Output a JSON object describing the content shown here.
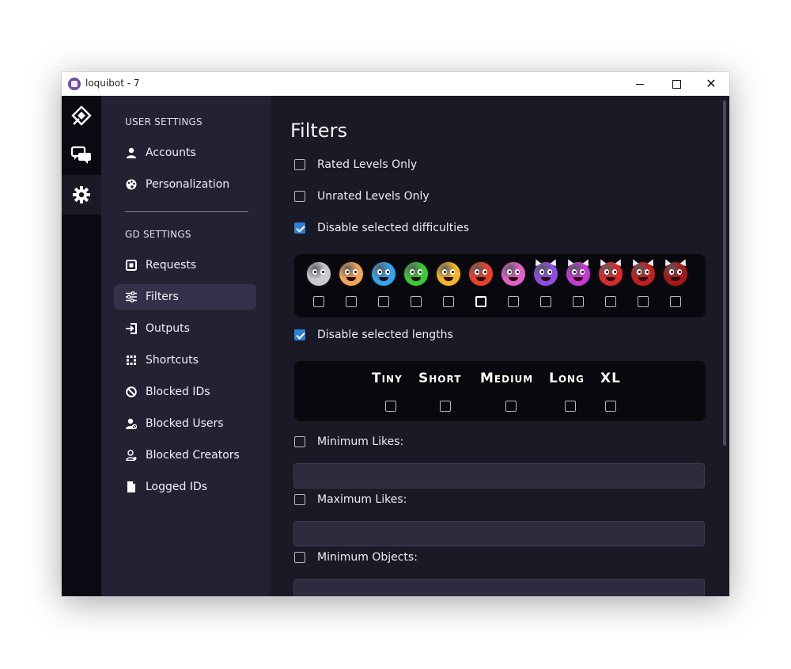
{
  "window": {
    "title": "loquibot - 7"
  },
  "sidebar": {
    "user_settings_label": "USER SETTINGS",
    "gd_settings_label": "GD SETTINGS",
    "items": [
      {
        "label": "Accounts",
        "icon": "user-icon"
      },
      {
        "label": "Personalization",
        "icon": "palette-icon"
      },
      {
        "label": "Requests",
        "icon": "requests-icon"
      },
      {
        "label": "Filters",
        "icon": "sliders-icon",
        "active": true
      },
      {
        "label": "Outputs",
        "icon": "output-icon"
      },
      {
        "label": "Shortcuts",
        "icon": "keyboard-icon"
      },
      {
        "label": "Blocked IDs",
        "icon": "ban-icon"
      },
      {
        "label": "Blocked Users",
        "icon": "user-blocked-icon"
      },
      {
        "label": "Blocked Creators",
        "icon": "user-outline-icon"
      },
      {
        "label": "Logged IDs",
        "icon": "file-icon"
      }
    ]
  },
  "main": {
    "title": "Filters",
    "options": {
      "rated_only": {
        "label": "Rated Levels Only",
        "checked": false
      },
      "unrated_only": {
        "label": "Unrated Levels Only",
        "checked": false
      },
      "disable_difficulties": {
        "label": "Disable selected difficulties",
        "checked": true
      },
      "disable_lengths": {
        "label": "Disable selected lengths",
        "checked": true
      },
      "min_likes": {
        "label": "Minimum Likes:",
        "checked": false,
        "value": ""
      },
      "max_likes": {
        "label": "Maximum Likes:",
        "checked": false,
        "value": ""
      },
      "min_objects": {
        "label": "Minimum Objects:",
        "checked": false,
        "value": ""
      }
    },
    "difficulties": [
      {
        "name": "na",
        "color": "#c9c9cf"
      },
      {
        "name": "auto",
        "color": "#f0a55a"
      },
      {
        "name": "easy",
        "color": "#33a4ee"
      },
      {
        "name": "normal",
        "color": "#39c937"
      },
      {
        "name": "hard",
        "color": "#f2b62c"
      },
      {
        "name": "harder",
        "color": "#e8402b"
      },
      {
        "name": "insane",
        "color": "#e060c8"
      },
      {
        "name": "easy-demon",
        "color": "#8a4fe0"
      },
      {
        "name": "medium-demon",
        "color": "#c43ad4"
      },
      {
        "name": "hard-demon",
        "color": "#d92b2b"
      },
      {
        "name": "insane-demon",
        "color": "#c21e1e"
      },
      {
        "name": "extreme-demon",
        "color": "#a41818"
      }
    ],
    "lengths": [
      "Tiny",
      "Short",
      "Medium",
      "Long",
      "XL"
    ]
  },
  "colors": {
    "accent": "#2f7fd6",
    "sidebar": "#232233",
    "rail": "#0b0911",
    "main": "#1a1a26"
  }
}
